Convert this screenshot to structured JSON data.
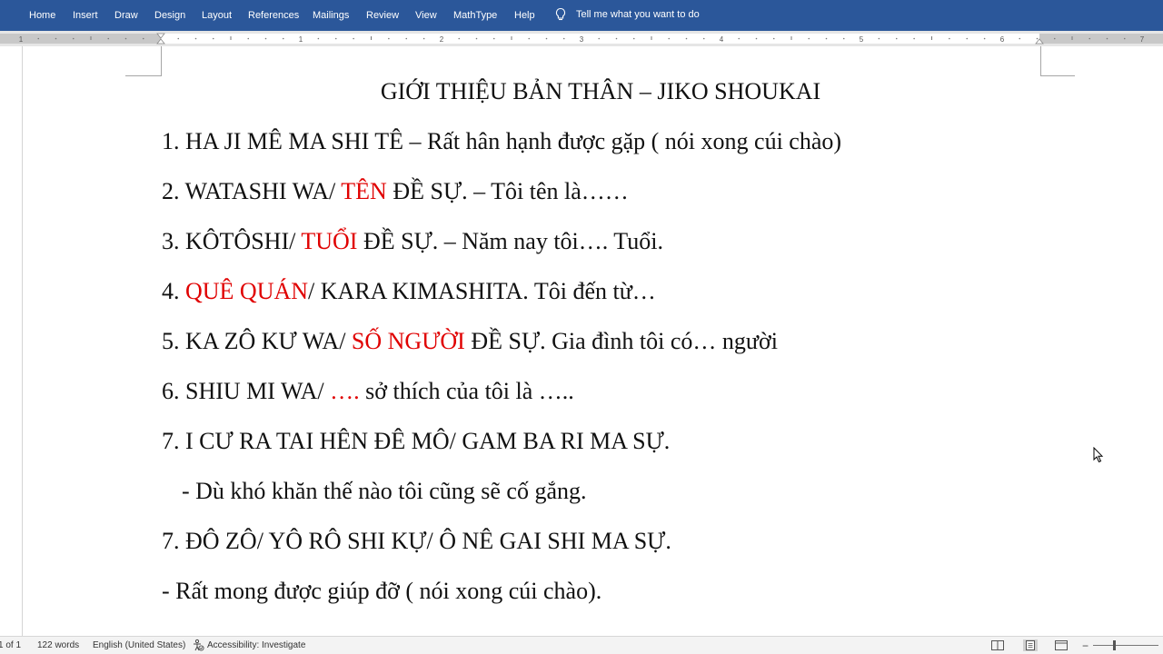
{
  "ribbon": {
    "tabs": [
      "Home",
      "Insert",
      "Draw",
      "Design",
      "Layout",
      "References",
      "Mailings",
      "Review",
      "View",
      "MathType",
      "Help"
    ],
    "tell_me": "Tell me what you want to do",
    "accent": "#2b579a"
  },
  "ruler": {
    "labels": [
      "1",
      "1",
      "2",
      "3",
      "4",
      "5",
      "6",
      "7"
    ]
  },
  "document": {
    "title": "GIỚI THIỆU BẢN THÂN – JIKO SHOUKAI",
    "lines": [
      [
        {
          "t": "1. HA JI MÊ MA SHI TÊ –  Rất hân hạnh được gặp ( nói xong cúi chào)",
          "red": false
        }
      ],
      [
        {
          "t": "2. WATASHI WA/  ",
          "red": false
        },
        {
          "t": "TÊN",
          "red": true
        },
        {
          "t": " ĐỀ SỰ. – Tôi tên là……",
          "red": false
        }
      ],
      [
        {
          "t": "3. KÔTÔSHI/  ",
          "red": false
        },
        {
          "t": "TUỔI",
          "red": true
        },
        {
          "t": " ĐỀ SỰ. – Năm nay tôi….  Tuổi.",
          "red": false
        }
      ],
      [
        {
          "t": "4. ",
          "red": false
        },
        {
          "t": "QUÊ QUÁN",
          "red": true
        },
        {
          "t": "/  KARA KIMASHITA. Tôi đến từ…",
          "red": false
        }
      ],
      [
        {
          "t": "5. KA ZÔ KƯ WA/  ",
          "red": false
        },
        {
          "t": "SỐ NGƯỜI",
          "red": true
        },
        {
          "t": " ĐỀ SỰ. Gia đình tôi có… người",
          "red": false
        }
      ],
      [
        {
          "t": "6. SHIU MI WA/ ",
          "red": false
        },
        {
          "t": "….",
          "red": true
        },
        {
          "t": " sở thích của tôi là …..",
          "red": false
        }
      ],
      [
        {
          "t": "7. I CƯ RA TAI HÊN ĐÊ MÔ/ GAM BA RI MA SỰ.",
          "red": false
        }
      ],
      [
        {
          "t": "- Dù khó khăn thế nào tôi cũng sẽ cố gắng.",
          "red": false
        }
      ],
      [
        {
          "t": "7. ĐÔ ZÔ/ YÔ RÔ SHI KỰ/ Ô NÊ GAI SHI MA SỰ.",
          "red": false
        }
      ],
      [
        {
          "t": "- Rất mong được giúp đỡ ( nói xong cúi chào).",
          "red": false
        }
      ]
    ],
    "highlight_color": "#e00000"
  },
  "status": {
    "page": "1 of 1",
    "words": "122 words",
    "language": "English (United States)",
    "accessibility": "Accessibility: Investigate"
  }
}
